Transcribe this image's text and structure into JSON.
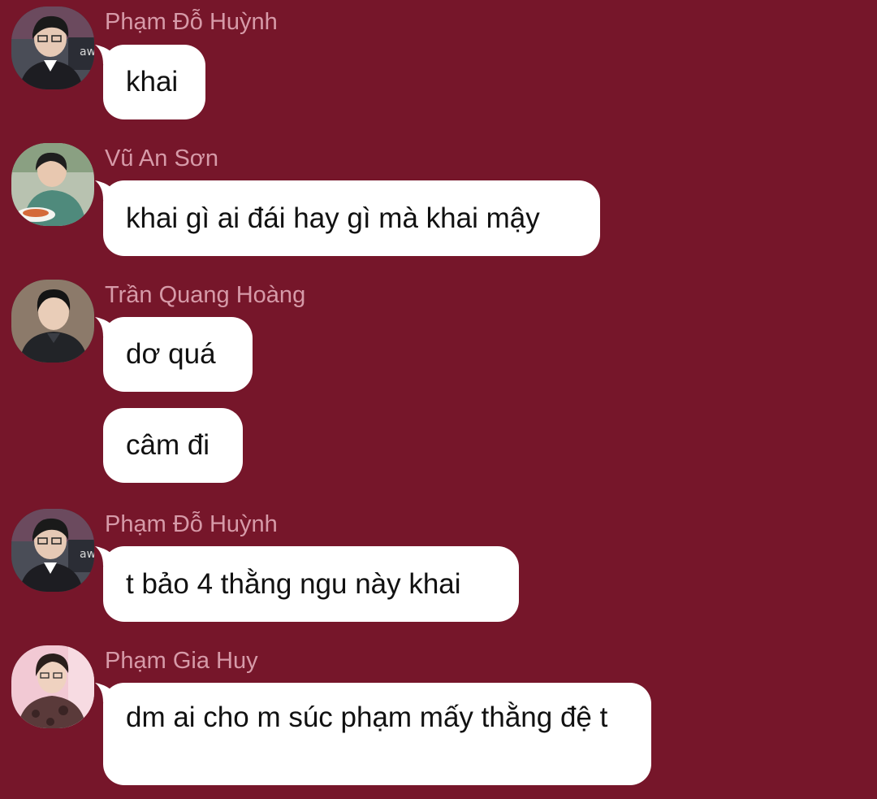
{
  "colors": {
    "background": "#76162a",
    "sender_name": "#d69aa8",
    "bubble": "#ffffff",
    "message_text": "#111111"
  },
  "messages": [
    {
      "sender": "Phạm Đỗ Huỳnh",
      "avatar_icon": "person-in-jersey-avatar",
      "bubbles": [
        "khai"
      ]
    },
    {
      "sender": "Vũ An Sơn",
      "avatar_icon": "person-eating-avatar",
      "bubbles": [
        "khai gì ai đái hay gì mà khai mậy"
      ]
    },
    {
      "sender": "Trần Quang Hoàng",
      "avatar_icon": "person-portrait-avatar",
      "bubbles": [
        "dơ quá",
        "câm đi"
      ]
    },
    {
      "sender": "Phạm Đỗ Huỳnh",
      "avatar_icon": "person-in-jersey-avatar",
      "bubbles": [
        "t bảo 4 thằng ngu này khai"
      ]
    },
    {
      "sender": "Phạm Gia Huy",
      "avatar_icon": "person-pink-background-avatar",
      "bubbles": [
        "dm ai cho m súc phạm mấy thằng đệ t"
      ]
    }
  ]
}
